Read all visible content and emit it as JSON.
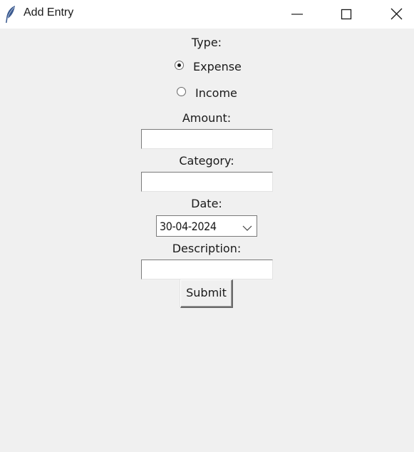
{
  "window": {
    "title": "Add Entry",
    "icon": "feather-icon",
    "controls": [
      "minimize-icon",
      "maximize-icon",
      "close-icon"
    ]
  },
  "form": {
    "type_label": "Type:",
    "type_options": [
      {
        "label": "Expense",
        "selected": true
      },
      {
        "label": "Income",
        "selected": false
      }
    ],
    "amount_label": "Amount:",
    "amount_value": "",
    "category_label": "Category:",
    "category_value": "",
    "date_label": "Date:",
    "date_value": "30-04-2024",
    "description_label": "Description:",
    "description_value": "",
    "submit_label": "Submit"
  },
  "colors": {
    "background": "#f0f0f0",
    "titlebar": "#ffffff",
    "feather_icon": "#3b5a8f"
  }
}
